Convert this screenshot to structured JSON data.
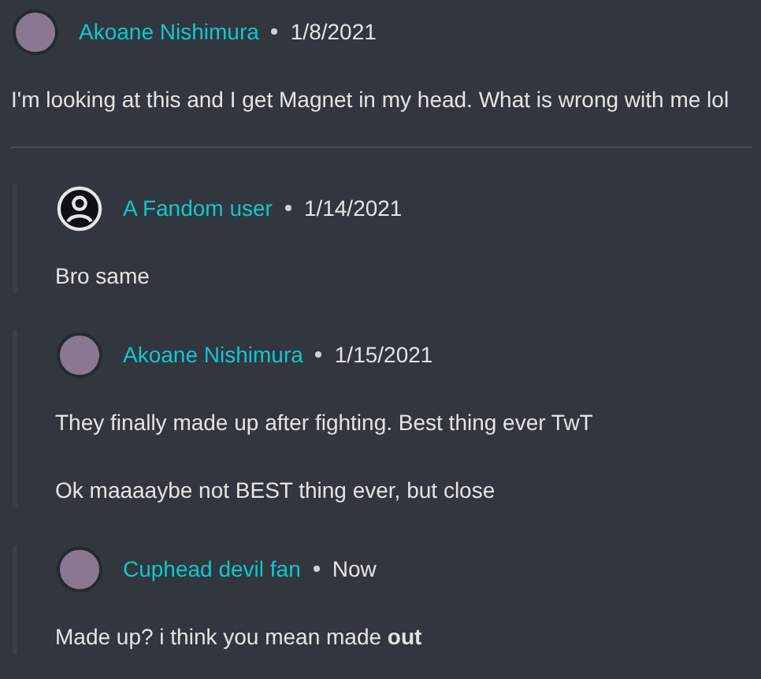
{
  "comment": {
    "author": "Akoane Nishimura",
    "default_avatar": false,
    "date": "1/8/2021",
    "paragraphs": [
      "I'm looking at this and I get Magnet in my head. What is wrong with me lol"
    ]
  },
  "replies": [
    {
      "author": "A Fandom user",
      "default_avatar": true,
      "date": "1/14/2021",
      "paragraphs": [
        "Bro same"
      ]
    },
    {
      "author": "Akoane Nishimura",
      "default_avatar": false,
      "date": "1/15/2021",
      "paragraphs": [
        "They finally made up after fighting. Best thing ever TwT",
        "Ok maaaaybe not BEST thing ever, but close"
      ]
    },
    {
      "author": "Cuphead devil fan",
      "default_avatar": false,
      "date": "Now",
      "paragraphs": [
        "Made up? i think you mean made **out**"
      ]
    }
  ]
}
